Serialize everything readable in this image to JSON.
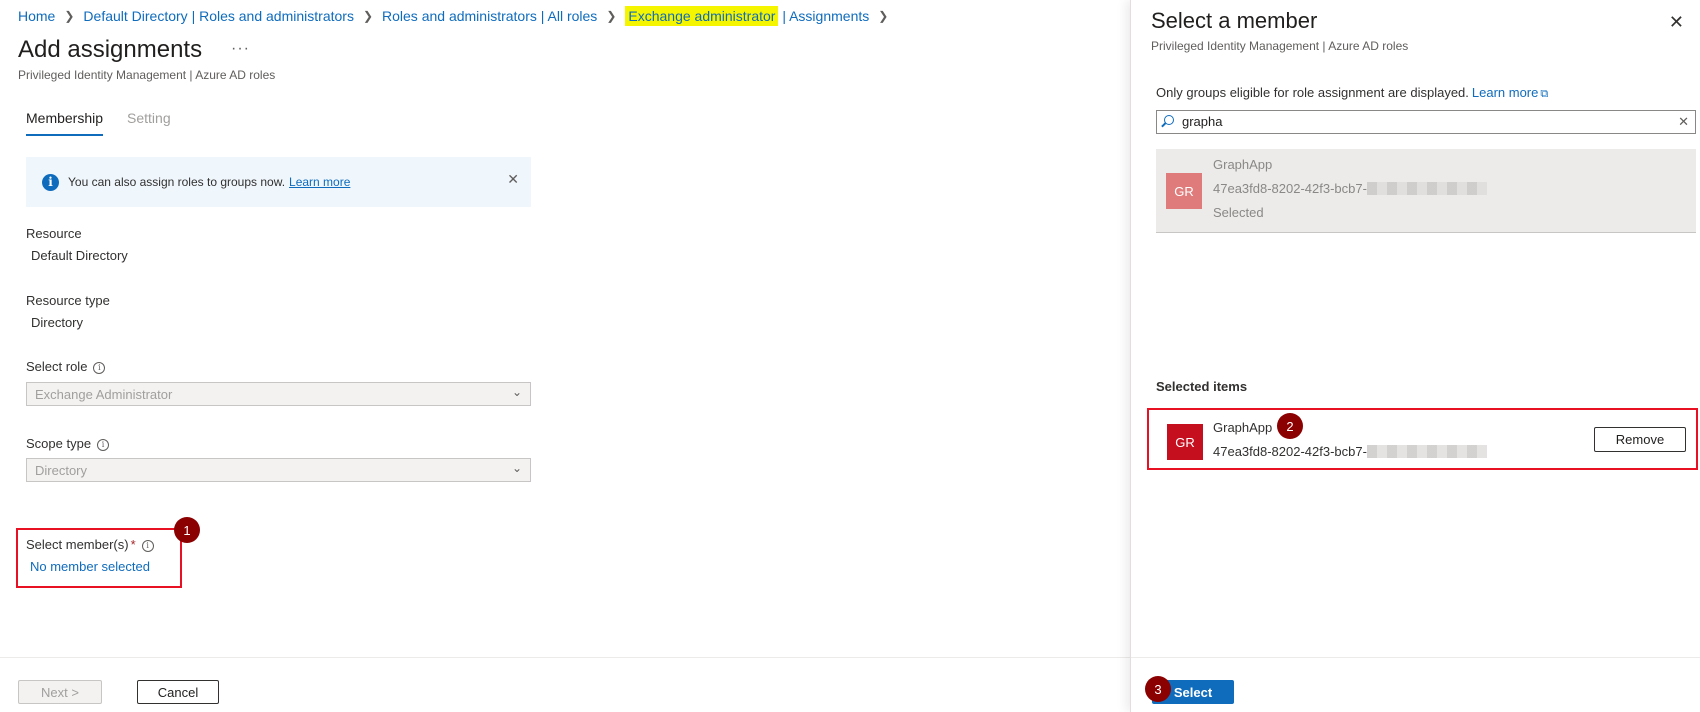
{
  "breadcrumb": [
    {
      "label": "Home"
    },
    {
      "label": "Default Directory | Roles and administrators"
    },
    {
      "label": "Roles and administrators | All roles"
    },
    {
      "label_highlight": "Exchange administrator",
      "label_rest": "| Assignments"
    }
  ],
  "page": {
    "title": "Add assignments",
    "more": "···",
    "subtitle": "Privileged Identity Management | Azure AD roles"
  },
  "tabs": [
    {
      "label": "Membership",
      "active": true
    },
    {
      "label": "Setting",
      "active": false
    }
  ],
  "banner": {
    "text": "You can also assign roles to groups now.",
    "link": "Learn more",
    "close": "✕"
  },
  "form": {
    "resource_label": "Resource",
    "resource_value": "Default Directory",
    "resource_type_label": "Resource type",
    "resource_type_value": "Directory",
    "select_role_label": "Select role",
    "select_role_value": "Exchange Administrator",
    "scope_type_label": "Scope type",
    "scope_type_value": "Directory",
    "members_label": "Select member(s)",
    "required_mark": "*",
    "members_value": "No member selected"
  },
  "steps": [
    "1",
    "2",
    "3"
  ],
  "footer": {
    "next": "Next >",
    "cancel": "Cancel"
  },
  "panel": {
    "title": "Select a member",
    "subtitle": "Privileged Identity Management | Azure AD roles",
    "close": "✕",
    "note": "Only groups eligible for role assignment are displayed.",
    "note_link": "Learn more",
    "search_value": "grapha",
    "search_clear": "✕",
    "result": {
      "initials": "GR",
      "name": "GraphApp",
      "id_prefix": "47ea3fd8-8202-42f3-bcb7-",
      "status": "Selected"
    },
    "selected_heading": "Selected items",
    "selected": {
      "initials": "GR",
      "name": "GraphApp",
      "id_prefix": "47ea3fd8-8202-42f3-bcb7-",
      "remove": "Remove"
    },
    "select_button": "Select"
  },
  "colors": {
    "accent": "#0f6cbd",
    "highlight": "#f5f500",
    "callout_border": "#e81123",
    "step_badge": "#8b0000",
    "avatar_selected": "#c50f1f",
    "avatar_dimmed": "#e07b7b"
  }
}
